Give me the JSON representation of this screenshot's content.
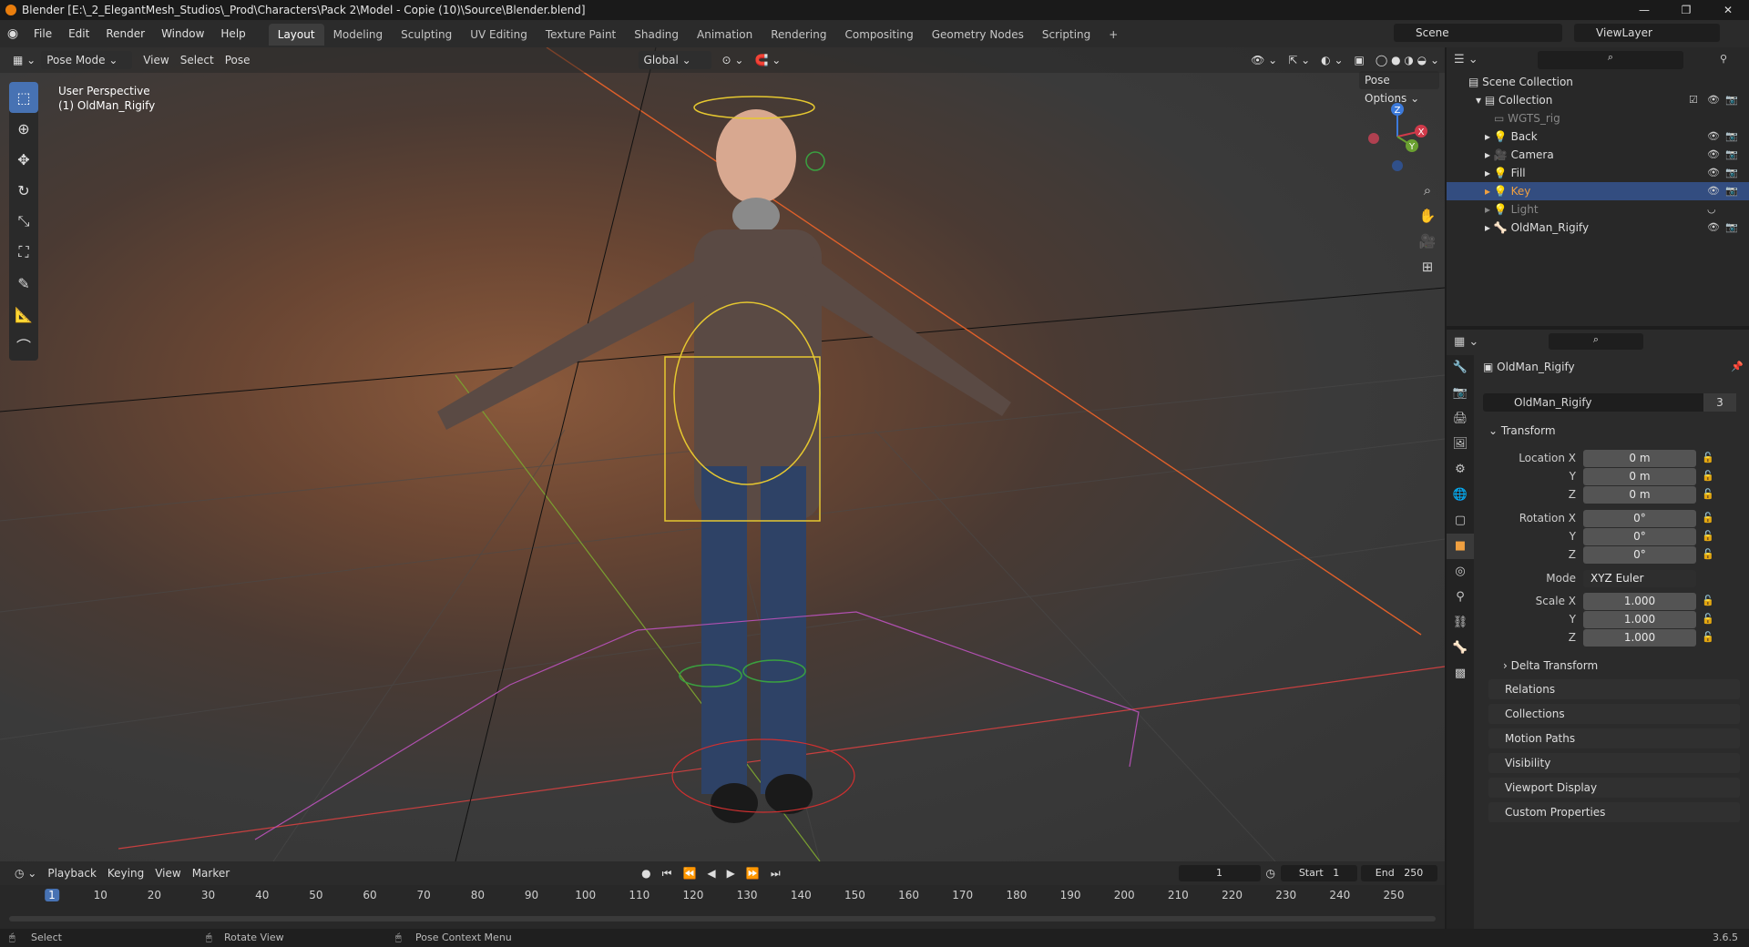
{
  "window": {
    "title": "Blender [E:\\_2_ElegantMesh_Studios\\_Prod\\Characters\\Pack 2\\Model - Copie (10)\\Source\\Blender.blend]",
    "minimize": "—",
    "maximize": "❐",
    "close": "✕"
  },
  "menu": [
    "File",
    "Edit",
    "Render",
    "Window",
    "Help"
  ],
  "workspaces": [
    "Layout",
    "Modeling",
    "Sculpting",
    "UV Editing",
    "Texture Paint",
    "Shading",
    "Animation",
    "Rendering",
    "Compositing",
    "Geometry Nodes",
    "Scripting"
  ],
  "active_workspace": "Layout",
  "add_workspace": "+",
  "scene": "Scene",
  "view_layer": "ViewLayer",
  "viewport": {
    "mode": "Pose Mode",
    "menus": [
      "View",
      "Select",
      "Pose"
    ],
    "orientation": "Global",
    "pose_options": "Pose Options",
    "perspective": "User Perspective",
    "active_object": "(1) OldMan_Rigify",
    "gizmo_axes": [
      "X",
      "Y",
      "Z"
    ]
  },
  "tools": [
    {
      "name": "select-box-tool",
      "icon": "⬚",
      "active": true
    },
    {
      "name": "cursor-tool",
      "icon": "⊕",
      "active": false
    },
    {
      "name": "move-tool",
      "icon": "✥",
      "active": false
    },
    {
      "name": "rotate-tool",
      "icon": "↻",
      "active": false
    },
    {
      "name": "scale-tool",
      "icon": "⤡",
      "active": false
    },
    {
      "name": "transform-tool",
      "icon": "⛶",
      "active": false
    },
    {
      "name": "annotate-tool",
      "icon": "✎",
      "active": false
    },
    {
      "name": "measure-tool",
      "icon": "📐",
      "active": false
    },
    {
      "name": "relax-pose-tool",
      "icon": "⌒",
      "active": false
    }
  ],
  "outliner": {
    "root": "Scene Collection",
    "collection": "Collection",
    "items": [
      {
        "name": "WGTS_rig",
        "selected": false,
        "dim": true
      },
      {
        "name": "Back",
        "selected": false,
        "dim": false
      },
      {
        "name": "Camera",
        "selected": false,
        "dim": false
      },
      {
        "name": "Fill",
        "selected": false,
        "dim": false
      },
      {
        "name": "Key",
        "selected": true,
        "dim": false
      },
      {
        "name": "Light",
        "selected": false,
        "dim": true
      },
      {
        "name": "OldMan_Rigify",
        "selected": false,
        "dim": false
      }
    ]
  },
  "properties": {
    "object_name": "OldMan_Rigify",
    "data_name": "OldMan_Rigify",
    "users": "3",
    "transform_label": "Transform",
    "location_label": "Location X",
    "rotation_label": "Rotation X",
    "scale_label": "Scale X",
    "y_label": "Y",
    "z_label": "Z",
    "location": [
      "0 m",
      "0 m",
      "0 m"
    ],
    "rotation": [
      "0°",
      "0°",
      "0°"
    ],
    "mode_label": "Mode",
    "mode": "XYZ Euler",
    "scale": [
      "1.000",
      "1.000",
      "1.000"
    ],
    "delta": "Delta Transform",
    "panels": [
      "Relations",
      "Collections",
      "Motion Paths",
      "Visibility",
      "Viewport Display",
      "Custom Properties"
    ]
  },
  "timeline": {
    "menus": [
      "Playback",
      "Keying",
      "View",
      "Marker"
    ],
    "current_frame": "1",
    "start_label": "Start",
    "start": "1",
    "end_label": "End",
    "end": "250",
    "ticks": [
      "1",
      "10",
      "20",
      "30",
      "40",
      "50",
      "60",
      "70",
      "80",
      "90",
      "100",
      "110",
      "120",
      "130",
      "140",
      "150",
      "160",
      "170",
      "180",
      "190",
      "200",
      "210",
      "220",
      "230",
      "240",
      "250"
    ]
  },
  "status": {
    "select": "Select",
    "rotate": "Rotate View",
    "context": "Pose Context Menu",
    "version": "3.6.5"
  }
}
